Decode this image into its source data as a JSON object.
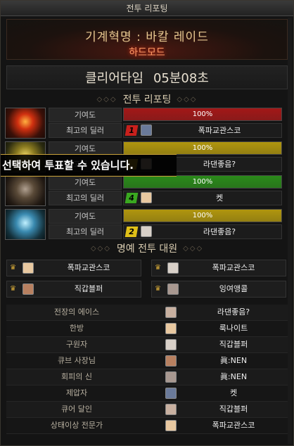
{
  "window": {
    "title": "전투 리포팅"
  },
  "banner": {
    "raid_name": "기계혁명 : 바칼 레이드",
    "difficulty": "하드모드"
  },
  "clear": {
    "label": "클리어타임",
    "time": "05분08초"
  },
  "report": {
    "heading": "전투 리포팅",
    "contribution_label": "기여도",
    "top_dealer_label": "최고의 딜러",
    "bosses": [
      {
        "contribution": "100%",
        "fill_pct": 100,
        "bar_color": "#a31818",
        "rank": "1",
        "rank_color": "#c8201c",
        "dealer": "폭파교관스코",
        "portrait": "fire"
      },
      {
        "contribution": "100%",
        "fill_pct": 100,
        "bar_color": "#b0960e",
        "rank": "",
        "rank_color": "#c8a010",
        "dealer": "라댄좋음?",
        "portrait": "gold"
      },
      {
        "contribution": "100%",
        "fill_pct": 100,
        "bar_color": "#2a8a1a",
        "rank": "4",
        "rank_color": "#3aa820",
        "dealer": "켓",
        "portrait": "dark"
      },
      {
        "contribution": "100%",
        "fill_pct": 100,
        "bar_color": "#b0960e",
        "rank": "2",
        "rank_color": "#e0c018",
        "dealer": "라댄좋음?",
        "portrait": "ice"
      }
    ]
  },
  "overlay": {
    "text": "선택하여 투표할 수 있습니다."
  },
  "honor": {
    "heading": "명예 전투 대원",
    "members": [
      "폭파교관스코",
      "폭파교관스코",
      "직갑블퍼",
      "잉여앵콜"
    ]
  },
  "titles": [
    {
      "title": "전장의 에이스",
      "player": "라댄좋음?"
    },
    {
      "title": "한방",
      "player": "룩나이트"
    },
    {
      "title": "구원자",
      "player": "직갑블퍼"
    },
    {
      "title": "큐브 사장님",
      "player": "眞:NEN"
    },
    {
      "title": "회피의 신",
      "player": "眞:NEN"
    },
    {
      "title": "제압자",
      "player": "켓"
    },
    {
      "title": "큐어 달인",
      "player": "직갑블퍼"
    },
    {
      "title": "상태이상 전문가",
      "player": "폭파교관스코"
    }
  ]
}
